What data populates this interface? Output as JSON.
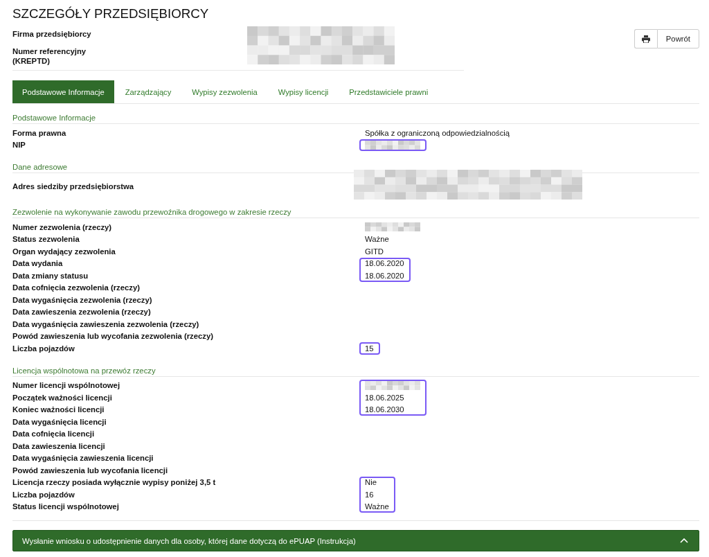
{
  "header": {
    "title": "SZCZEGÓŁY PRZEDSIĘBIORCY",
    "fields": [
      {
        "label": "Firma przedsiębiorcy"
      },
      {
        "label": "Numer referencyjny (KREPTD)"
      }
    ],
    "actions": [
      {
        "kind": "print"
      },
      {
        "kind": "text",
        "label": "Powrót"
      }
    ]
  },
  "tabs": [
    {
      "label": "Podstawowe Informacje",
      "selected": true
    },
    {
      "label": "Zarządzający",
      "selected": false
    },
    {
      "label": "Wypisy zezwolenia",
      "selected": false
    },
    {
      "label": "Wypisy licencji",
      "selected": false
    },
    {
      "label": "Przedstawiciele prawni",
      "selected": false
    }
  ],
  "sections": [
    {
      "title": "Podstawowe Informacje",
      "blocks": [
        {
          "highlighted": false,
          "rows": [
            {
              "label": "Forma prawna",
              "kind": "text",
              "value": "Spółka z ograniczoną odpowiedzialnością"
            }
          ]
        },
        {
          "highlighted": true,
          "rows": [
            {
              "label": "NIP",
              "kind": "redacted"
            }
          ]
        }
      ]
    },
    {
      "title": "Dane adresowe",
      "blocks": [
        {
          "highlighted": false,
          "rows": [
            {
              "label": "Adres siedziby przedsiębiorstwa",
              "kind": "redacted-wide"
            }
          ]
        }
      ]
    },
    {
      "title": "Zezwolenie na wykonywanie zawodu przewoźnika drogowego w zakresie rzeczy",
      "blocks": [
        {
          "highlighted": false,
          "rows": [
            {
              "label": "Numer zezwolenia (rzeczy)",
              "kind": "redacted"
            },
            {
              "label": "Status zezwolenia",
              "kind": "text",
              "value": "Ważne"
            },
            {
              "label": "Organ wydający zezwolenia",
              "kind": "text",
              "value": "GITD"
            }
          ]
        },
        {
          "highlighted": true,
          "rows": [
            {
              "label": "Data wydania",
              "kind": "text",
              "value": "18.06.2020"
            },
            {
              "label": "Data zmiany statusu",
              "kind": "text",
              "value": "18.06.2020"
            }
          ]
        },
        {
          "highlighted": false,
          "rows": [
            {
              "label": "Data cofnięcia zezwolenia (rzeczy)",
              "kind": "text"
            },
            {
              "label": "Data wygaśnięcia zezwolenia (rzeczy)",
              "kind": "text"
            },
            {
              "label": "Data zawieszenia zezwolenia (rzeczy)",
              "kind": "text"
            },
            {
              "label": "Data wygaśnięcia zawieszenia zezwolenia (rzeczy)",
              "kind": "text"
            },
            {
              "label": "Powód zawieszenia lub wycofania zezwolenia (rzeczy)",
              "kind": "text"
            }
          ]
        },
        {
          "highlighted": true,
          "rows": [
            {
              "label": "Liczba pojazdów",
              "kind": "text",
              "value": "15"
            }
          ]
        }
      ]
    },
    {
      "title": "Licencja wspólnotowa na przewóz rzeczy",
      "blocks": [
        {
          "highlighted": true,
          "rows": [
            {
              "label": "Numer licencji wspólnotowej",
              "kind": "redacted"
            },
            {
              "label": "Początek ważności licencji",
              "kind": "text",
              "value": "18.06.2025"
            },
            {
              "label": "Koniec ważności licencji",
              "kind": "text",
              "value": "18.06.2030"
            }
          ]
        },
        {
          "highlighted": false,
          "rows": [
            {
              "label": "Data wygaśnięcia licencji",
              "kind": "text"
            },
            {
              "label": "Data cofnięcia licencji",
              "kind": "text"
            },
            {
              "label": "Data zawieszenia licencji",
              "kind": "text"
            },
            {
              "label": "Data wygaśnięcia zawieszenia licencji",
              "kind": "text"
            },
            {
              "label": "Powód zawieszenia lub wycofania licencji",
              "kind": "text"
            }
          ]
        },
        {
          "highlighted": true,
          "rows": [
            {
              "label": "Licencja rzeczy posiada wyłącznie wypisy poniżej 3,5 t",
              "kind": "text",
              "value": "Nie"
            },
            {
              "label": "Liczba pojazdów",
              "kind": "text",
              "value": "16"
            },
            {
              "label": "Status licencji wspólnotowej",
              "kind": "text",
              "value": "Ważne"
            }
          ]
        }
      ]
    }
  ],
  "accordion": {
    "title": "Wysłanie wniosku o udostępnienie danych dla osoby, której dane dotyczą do ePUAP (Instrukcja)"
  }
}
